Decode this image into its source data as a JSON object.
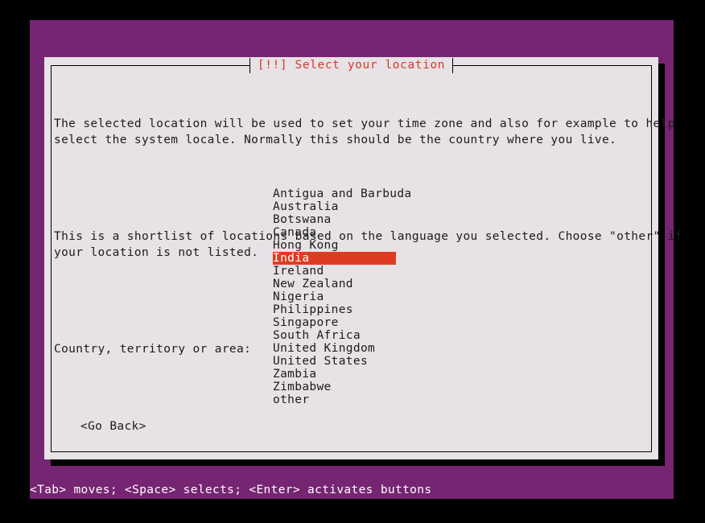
{
  "installer": {
    "dialog_title": "[!!] Select your location",
    "paragraphs": [
      "The selected location will be used to set your time zone and also for example to help\nselect the system locale. Normally this should be the country where you live.",
      "This is a shortlist of locations based on the language you selected. Choose \"other\" if\nyour location is not listed."
    ],
    "list_label": "Country, territory or area:",
    "countries": [
      "Antigua and Barbuda",
      "Australia",
      "Botswana",
      "Canada",
      "Hong Kong",
      "India",
      "Ireland",
      "New Zealand",
      "Nigeria",
      "Philippines",
      "Singapore",
      "South Africa",
      "United Kingdom",
      "United States",
      "Zambia",
      "Zimbabwe",
      "other"
    ],
    "selected_country": "India",
    "selected_index": 5,
    "go_back_label": "<Go Back>",
    "status_help": "<Tab> moves; <Space> selects; <Enter> activates buttons",
    "colors": {
      "terminal_background": "#762572",
      "dialog_background": "#e6e2e6",
      "dialog_text": "#1c1c1c",
      "title_text": "#d93a24",
      "selection_background": "#de3c22",
      "selection_text": "#ffffff",
      "status_text": "#ffffff",
      "screen_background": "#000000"
    }
  }
}
